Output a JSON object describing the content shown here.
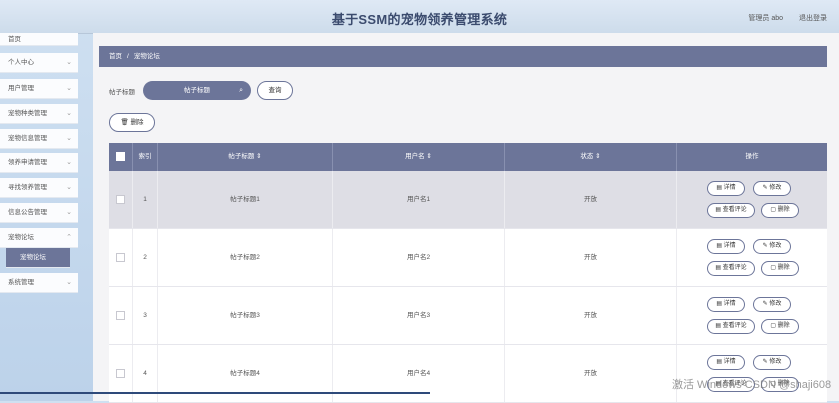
{
  "header": {
    "title": "基于SSM的宠物领养管理系统",
    "welcome": "管理员 abo",
    "logout": "退出登录"
  },
  "sidebar": {
    "items": [
      {
        "label": "首页",
        "chevron": false
      },
      {
        "label": "个人中心",
        "chevron": true
      },
      {
        "label": "用户管理",
        "chevron": true
      },
      {
        "label": "宠物种类管理",
        "chevron": true
      },
      {
        "label": "宠物信息管理",
        "chevron": true
      },
      {
        "label": "领养申请管理",
        "chevron": true
      },
      {
        "label": "寻找领养管理",
        "chevron": true
      },
      {
        "label": "信息公告管理",
        "chevron": true
      },
      {
        "label": "宠物论坛",
        "chevron": true
      },
      {
        "label": "系统管理",
        "chevron": true
      }
    ],
    "active_sub": "宠物论坛"
  },
  "breadcrumb": {
    "home": "首页",
    "separator": "/",
    "current": "宠物论坛"
  },
  "search": {
    "label": "帖子标题",
    "placeholder": "帖子标题",
    "button": "查询"
  },
  "toolbar": {
    "delete": "删除"
  },
  "table": {
    "columns": [
      "索引",
      "帖子标题 ⇕",
      "用户名 ⇕",
      "状态 ⇕",
      "操作"
    ],
    "rows": [
      {
        "index": "1",
        "title": "帖子标题1",
        "user": "用户名1",
        "status": "开放",
        "highlighted": true
      },
      {
        "index": "2",
        "title": "帖子标题2",
        "user": "用户名2",
        "status": "开放",
        "highlighted": false
      },
      {
        "index": "3",
        "title": "帖子标题3",
        "user": "用户名3",
        "status": "开放",
        "highlighted": false
      },
      {
        "index": "4",
        "title": "帖子标题4",
        "user": "用户名4",
        "status": "开放",
        "highlighted": false
      }
    ],
    "actions": {
      "detail": "详情",
      "edit": "修改",
      "comments": "查看评论",
      "delete": "删除"
    }
  },
  "watermark": "激活 Windows CSDN @shaji608",
  "colors": {
    "accent": "#6c7599",
    "sidebar_bg": "#c4d8ee"
  }
}
